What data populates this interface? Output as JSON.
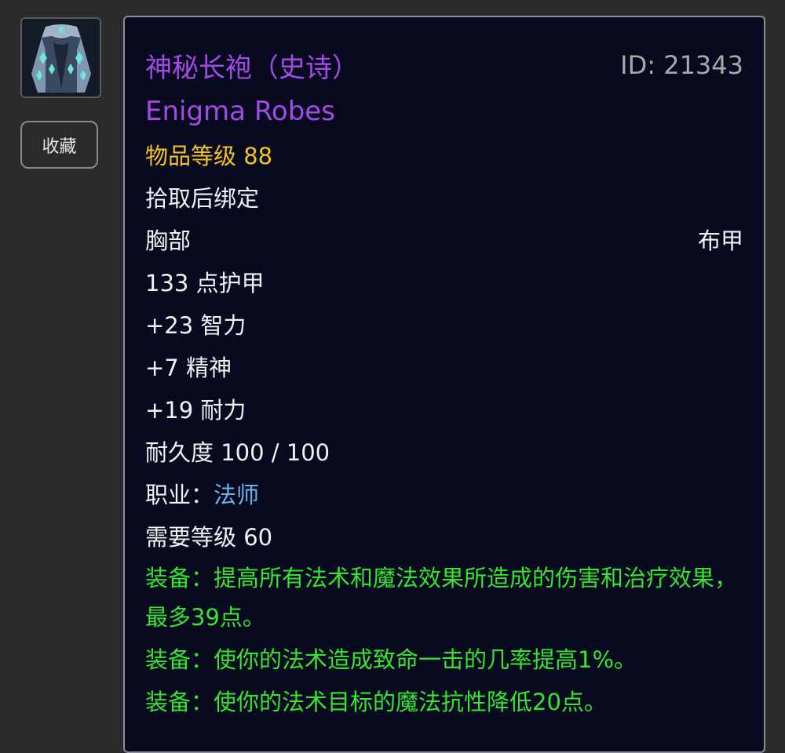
{
  "sidebar": {
    "icon_name": "robe-icon",
    "favorite_label": "收藏"
  },
  "item": {
    "name_cn": "神秘长袍（史诗）",
    "id_label": "ID: 21343",
    "name_en": "Enigma Robes",
    "item_level": "物品等级 88",
    "binding": "拾取后绑定",
    "slot": "胸部",
    "armor_type": "布甲",
    "armor": "133 点护甲",
    "stat_int": "+23 智力",
    "stat_spi": "+7 精神",
    "stat_sta": "+19 耐力",
    "durability": "耐久度 100 / 100",
    "class_label": "职业：",
    "class_value": "法师",
    "required_level": "需要等级 60",
    "equip_effects": [
      "装备：提高所有法术和魔法效果所造成的伤害和治疗效果，最多39点。",
      "装备：使你的法术造成致命一击的几率提高1%。",
      "装备：使你的法术目标的魔法抗性降低20点。"
    ]
  },
  "colors": {
    "epic": "#a24be6",
    "item_level": "#f3c421",
    "class": "#68b6e6",
    "equip": "#35e52e",
    "tooltip_bg": "#080a1f"
  }
}
